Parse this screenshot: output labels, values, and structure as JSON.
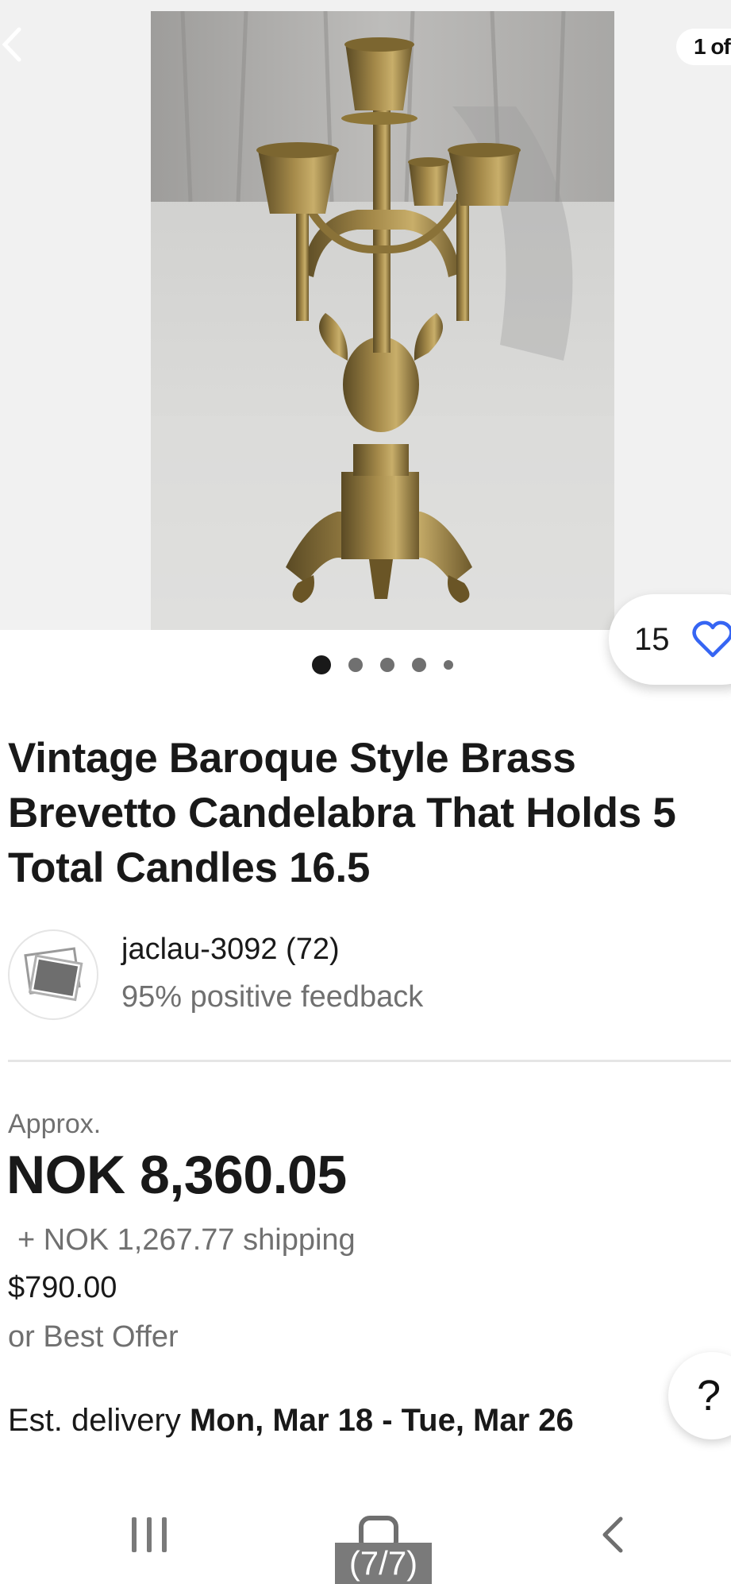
{
  "gallery": {
    "counter_text": "1 of",
    "watch_count": "15",
    "dots_count": 5,
    "active_dot": 0
  },
  "listing": {
    "title": "Vintage Baroque Style Brass Brevetto Candelabra That Holds 5 Total Candles 16.5"
  },
  "seller": {
    "name": "jaclau-3092 (72)",
    "feedback": "95% positive feedback"
  },
  "pricing": {
    "approx_label": "Approx.",
    "price": "NOK 8,360.05",
    "shipping": "+ NOK 1,267.77 shipping",
    "original_price": "$790.00",
    "best_offer": "or Best Offer"
  },
  "delivery": {
    "label": "Est. delivery",
    "dates": "Mon, Mar 18 - Tue, Mar 26"
  },
  "help": {
    "label": "?"
  },
  "overlay": {
    "page_tag": "(7/7)"
  },
  "colors": {
    "text_primary": "#191919",
    "text_secondary": "#707070",
    "heart_blue": "#3665f3",
    "divider": "#e5e5e5"
  },
  "icons": {
    "back": "chevron-left-icon",
    "watch": "heart-icon",
    "avatar": "photo-placeholder-icon"
  }
}
